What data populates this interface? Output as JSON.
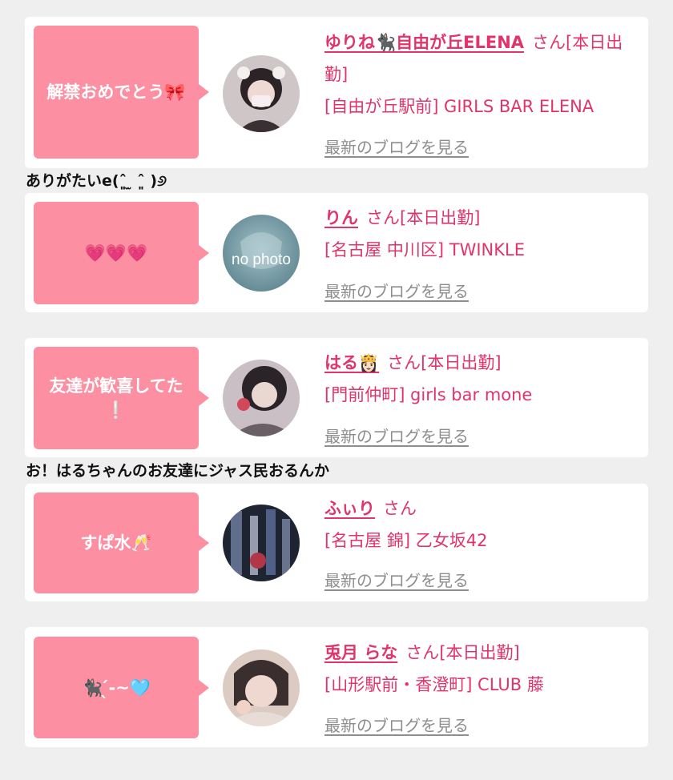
{
  "entries": [
    {
      "message": "解禁おめでとう🎀",
      "name": "ゆりね🐈‍⬛自由が丘ELENA",
      "san": "さん",
      "status": "[本日出勤]",
      "shop": "[自由が丘駅前] GIRLS BAR ELENA",
      "blog": "最新のブログを見る",
      "avatar": "girl-photo"
    },
    {
      "message": "💗💗💗",
      "name": "りん",
      "san": "さん",
      "status": "[本日出勤]",
      "shop": "[名古屋 中川区] TWINKLE",
      "blog": "最新のブログを見る",
      "avatar": "no photo"
    },
    {
      "message": "友達が歓喜してた❕",
      "name": "はる👸🏻",
      "san": "さん",
      "status": "[本日出勤]",
      "shop": "[門前仲町] girls bar mone",
      "blog": "最新のブログを見る",
      "avatar": "girl-photo"
    },
    {
      "message": "すぱ水🥂",
      "name": "ふぃり",
      "san": "さん",
      "status": "",
      "shop": "[名古屋 錦] 乙女坂42",
      "blog": "最新のブログを見る",
      "avatar": "girl-photo"
    },
    {
      "message": "🐈‍⬛‪‪ ̖́-‬~🩵",
      "name": "兎月 らな",
      "san": "さん",
      "status": "[本日出勤]",
      "shop": "[山形駅前・香澄町] CLUB 藤",
      "blog": "最新のブログを見る",
      "avatar": "girl-photo"
    }
  ],
  "comments": [
    "ありがたいe(ˆ͈ ̫ ˆ͈ )୬",
    "お！はるちゃんのお友達にジャス民おるんか"
  ],
  "colors": {
    "background": "#efeff0",
    "bubble": "#fc8fa1",
    "accent": "#e0346a",
    "link_gray": "#8e8e8e"
  }
}
